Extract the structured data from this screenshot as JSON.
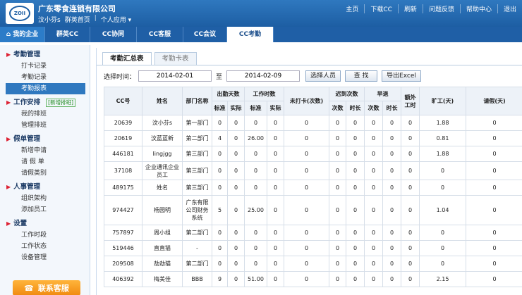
{
  "header": {
    "logo_text": "ZOII",
    "company": "广东零食连锁有限公司",
    "user": "汶小芬s",
    "home_link": "群英首页",
    "personal_app": "个人应用",
    "top_links": [
      "主页",
      "下载CC",
      "刷新",
      "问题反馈",
      "帮助中心",
      "退出"
    ]
  },
  "main_nav": [
    {
      "label": "我的企业",
      "active": false
    },
    {
      "label": "群英CC",
      "active": false
    },
    {
      "label": "CC协同",
      "active": false
    },
    {
      "label": "CC客服",
      "active": false
    },
    {
      "label": "CC会议",
      "active": false
    },
    {
      "label": "CC考勤",
      "active": true
    }
  ],
  "sidebar": {
    "groups": [
      {
        "title": "考勤管理",
        "badge": "",
        "items": [
          {
            "label": "打卡记录",
            "active": false
          },
          {
            "label": "考勤记录",
            "active": false
          },
          {
            "label": "考勤报表",
            "active": true
          }
        ]
      },
      {
        "title": "工作安排",
        "badge": "[新增排班]",
        "items": [
          {
            "label": "我的排班",
            "active": false
          },
          {
            "label": "管理排班",
            "active": false
          }
        ]
      },
      {
        "title": "假单管理",
        "badge": "",
        "items": [
          {
            "label": "新增申请",
            "active": false
          },
          {
            "label": "请 假 单",
            "active": false
          },
          {
            "label": "请假类别",
            "active": false
          }
        ]
      },
      {
        "title": "人事管理",
        "badge": "",
        "items": [
          {
            "label": "组织架构",
            "active": false
          },
          {
            "label": "添加员工",
            "active": false
          }
        ]
      },
      {
        "title": "设置",
        "badge": "",
        "items": [
          {
            "label": "工作时段",
            "active": false
          },
          {
            "label": "工作状态",
            "active": false
          },
          {
            "label": "设备管理",
            "active": false
          }
        ]
      }
    ],
    "service_button": "联系客服"
  },
  "content": {
    "tabs": [
      {
        "label": "考勤汇总表",
        "active": true
      },
      {
        "label": "考勤卡表",
        "active": false
      }
    ],
    "filter": {
      "label": "选择时间：",
      "start_date": "2014-02-01",
      "to_label": "至",
      "end_date": "2014-02-09",
      "select_person": "选择人员",
      "search": "查 找",
      "export": "导出Excel"
    },
    "table": {
      "headers": {
        "cc_no": "CC号",
        "name": "姓名",
        "dept": "部门名称",
        "attendance_days": "出勤天数",
        "work_hours": "工作时数",
        "no_punch": "未打卡(次数)",
        "late": "迟到次数",
        "early": "早退",
        "overtime": "额外工时",
        "absent": "旷工(天)",
        "leave": "请假(天)",
        "standard": "标准",
        "actual": "实际",
        "times": "次数",
        "duration": "时长"
      },
      "rows": [
        [
          "20639",
          "汶小芬s",
          "第一部门",
          "0",
          "0",
          "0",
          "0",
          "0",
          "0",
          "0",
          "0",
          "0",
          "0",
          "1.88",
          "0"
        ],
        [
          "20619",
          "汶蓝蓝新",
          "第二部门",
          "4",
          "0",
          "26.00",
          "0",
          "0",
          "0",
          "0",
          "0",
          "0",
          "0",
          "0.81",
          "0"
        ],
        [
          "446181",
          "lingjgg",
          "第三部门",
          "0",
          "0",
          "0",
          "0",
          "0",
          "0",
          "0",
          "0",
          "0",
          "0",
          "1.88",
          "0"
        ],
        [
          "37108",
          "企业通讯企业员工",
          "第三部门",
          "0",
          "0",
          "0",
          "0",
          "0",
          "0",
          "0",
          "0",
          "0",
          "0",
          "0",
          "0"
        ],
        [
          "489175",
          "姓名",
          "第三部门",
          "0",
          "0",
          "0",
          "0",
          "0",
          "0",
          "0",
          "0",
          "0",
          "0",
          "0",
          "0"
        ],
        [
          "974427",
          "杨园明",
          "广东有限公司财务系统",
          "5",
          "0",
          "25.00",
          "0",
          "0",
          "0",
          "0",
          "0",
          "0",
          "0",
          "1.04",
          "0"
        ],
        [
          "757897",
          "周小组",
          "第二部门",
          "0",
          "0",
          "0",
          "0",
          "0",
          "0",
          "0",
          "0",
          "0",
          "0",
          "0",
          "0"
        ],
        [
          "519446",
          "直直猫",
          "-",
          "0",
          "0",
          "0",
          "0",
          "0",
          "0",
          "0",
          "0",
          "0",
          "0",
          "0",
          "0"
        ],
        [
          "209508",
          "劫劫猫",
          "第二部门",
          "0",
          "0",
          "0",
          "0",
          "0",
          "0",
          "0",
          "0",
          "0",
          "0",
          "0",
          "0"
        ],
        [
          "406392",
          "梅美佳",
          "BBB",
          "9",
          "0",
          "51.00",
          "0",
          "0",
          "0",
          "0",
          "0",
          "0",
          "0",
          "2.15",
          "0"
        ]
      ]
    }
  }
}
